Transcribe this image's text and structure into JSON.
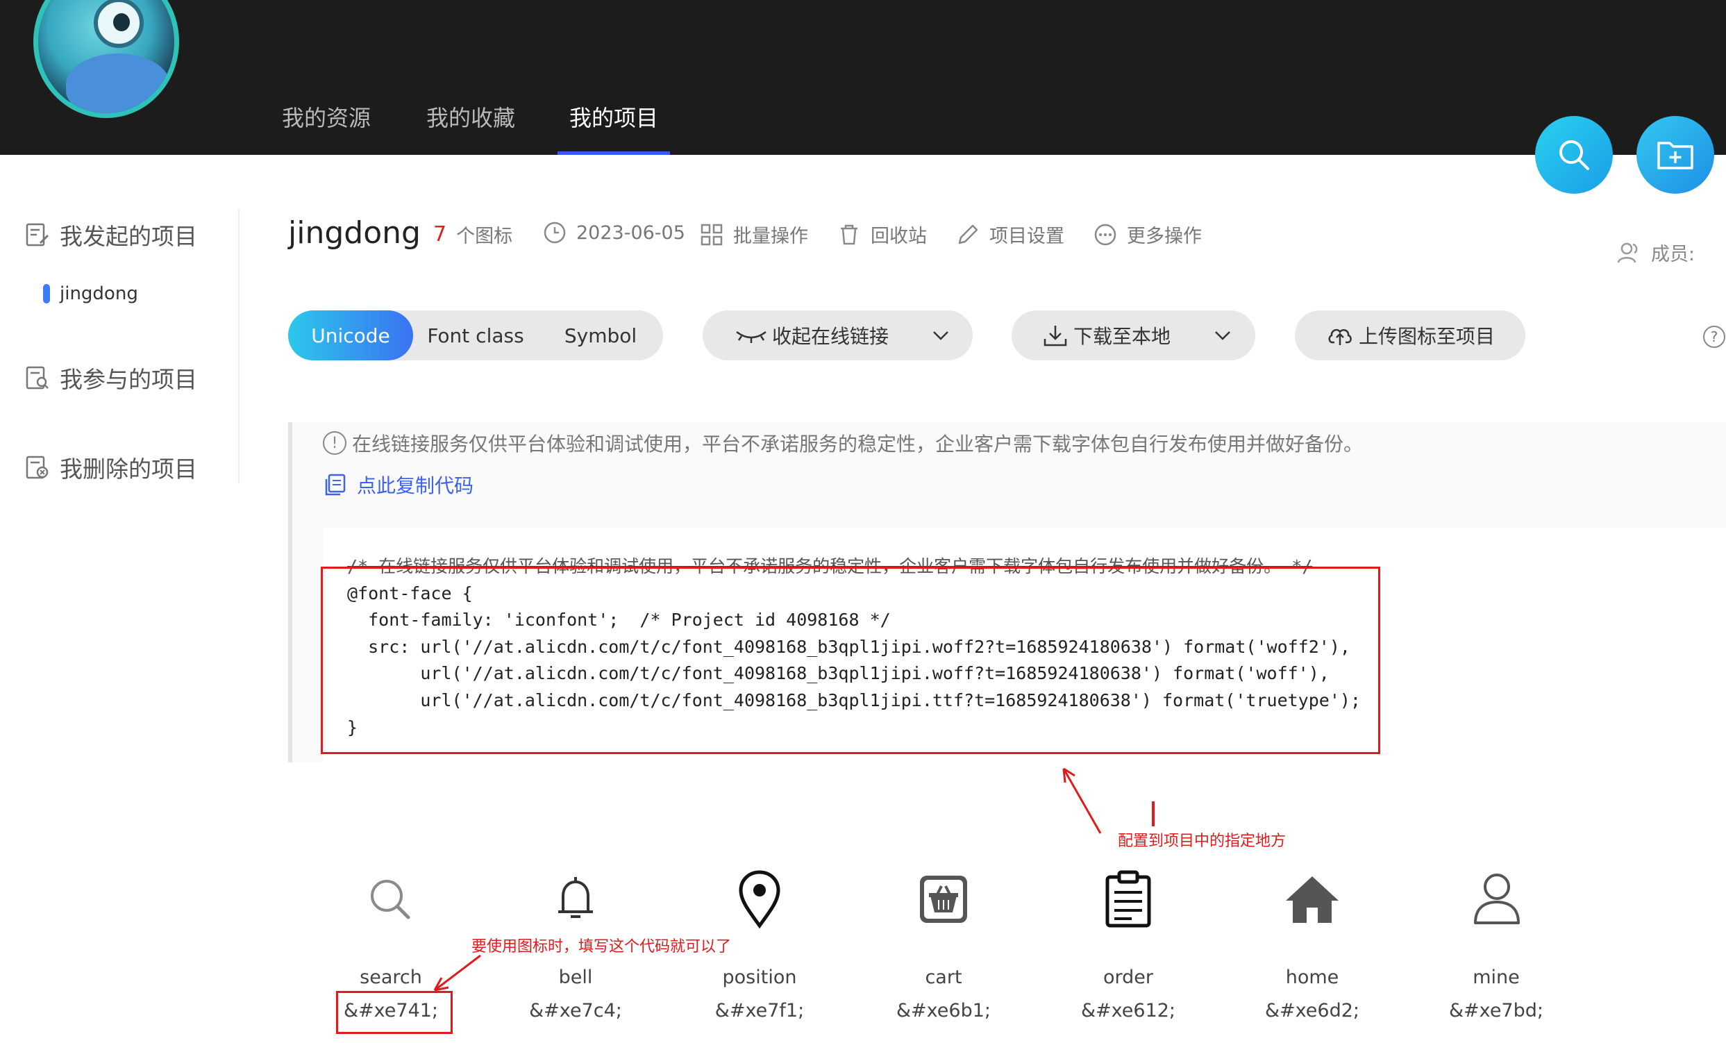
{
  "nav": {
    "tabs": [
      "我的资源",
      "我的收藏",
      "我的项目"
    ],
    "active_index": 2
  },
  "sidebar": {
    "items": [
      {
        "label": "我发起的项目",
        "icon": "edit-doc-icon"
      },
      {
        "label": "我参与的项目",
        "icon": "search-doc-icon"
      },
      {
        "label": "我删除的项目",
        "icon": "delete-doc-icon"
      }
    ],
    "sub_item": "jingdong"
  },
  "project": {
    "title": "jingdong",
    "count": "7",
    "count_unit": "个图标",
    "date": "2023-06-05",
    "actions": [
      "批量操作",
      "回收站",
      "项目设置",
      "更多操作"
    ],
    "members_label": "成员:"
  },
  "toolbar": {
    "segments": [
      "Unicode",
      "Font class",
      "Symbol"
    ],
    "active_segment": 0,
    "collapse_link": "收起在线链接",
    "download": "下载至本地",
    "upload": "上传图标至项目"
  },
  "notice": {
    "text": "在线链接服务仅供平台体验和调试使用，平台不承诺服务的稳定性，企业客户需下载字体包自行发布使用并做好备份。",
    "copy_link": "点此复制代码"
  },
  "code_lines": [
    "/* 在线链接服务仅供平台体验和调试使用，平台不承诺服务的稳定性，企业客户需下载字体包自行发布使用并做好备份。 */",
    "@font-face {",
    "  font-family: 'iconfont';  /* Project id 4098168 */",
    "  src: url('//at.alicdn.com/t/c/font_4098168_b3qpl1jipi.woff2?t=1685924180638') format('woff2'),",
    "       url('//at.alicdn.com/t/c/font_4098168_b3qpl1jipi.woff?t=1685924180638') format('woff'),",
    "       url('//at.alicdn.com/t/c/font_4098168_b3qpl1jipi.ttf?t=1685924180638') format('truetype');",
    "}"
  ],
  "annotations": {
    "config_note": "配置到项目中的指定地方",
    "usage_note": "要使用图标时，填写这个代码就可以了"
  },
  "icons": [
    {
      "name": "search",
      "code": "&#xe741;",
      "icon": "search-icon"
    },
    {
      "name": "bell",
      "code": "&#xe7c4;",
      "icon": "bell-icon"
    },
    {
      "name": "position",
      "code": "&#xe7f1;",
      "icon": "location-pin-icon"
    },
    {
      "name": "cart",
      "code": "&#xe6b1;",
      "icon": "cart-icon"
    },
    {
      "name": "order",
      "code": "&#xe612;",
      "icon": "clipboard-icon"
    },
    {
      "name": "home",
      "code": "&#xe6d2;",
      "icon": "home-icon"
    },
    {
      "name": "mine",
      "code": "&#xe7bd;",
      "icon": "user-icon"
    }
  ],
  "colors": {
    "header_bg": "#1c1c1c",
    "accent_blue": "#3b57f5",
    "link_blue": "#3b62f2",
    "annotation_red": "#e01b1b",
    "count_red": "#e02020"
  }
}
